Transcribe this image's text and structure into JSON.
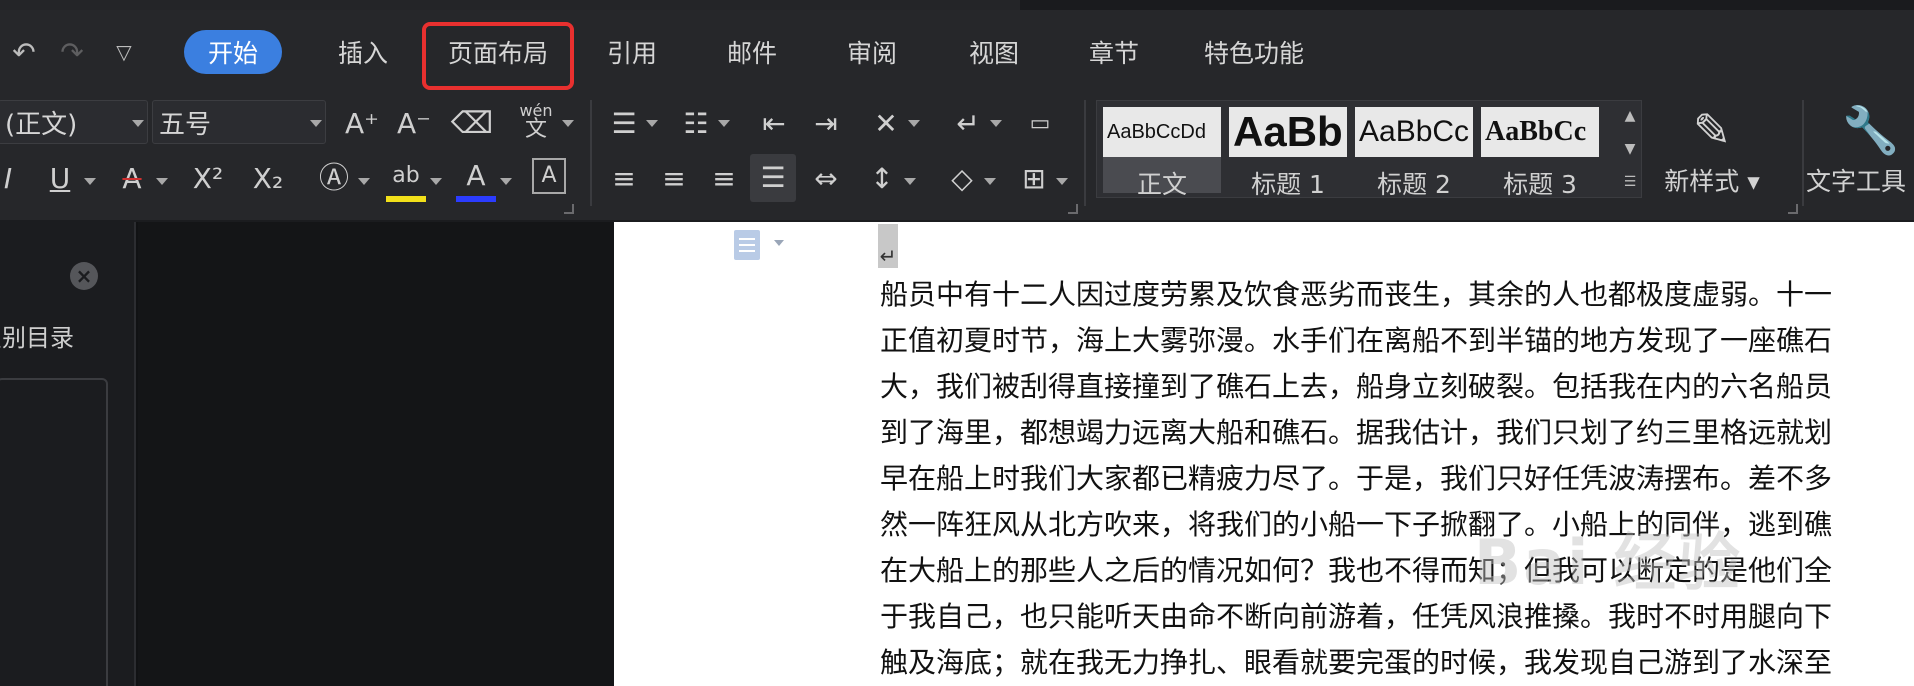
{
  "tabs": [
    {
      "label": "开始",
      "active": true
    },
    {
      "label": "插入"
    },
    {
      "label": "页面布局",
      "highlighted": true
    },
    {
      "label": "引用"
    },
    {
      "label": "邮件"
    },
    {
      "label": "审阅"
    },
    {
      "label": "视图"
    },
    {
      "label": "章节"
    },
    {
      "label": "特色功能"
    }
  ],
  "quick_access": {
    "undo_icon": "undo-icon",
    "redo_icon": "redo-icon",
    "customize_icon": "chevron-down-icon"
  },
  "ribbon": {
    "font_name": "(正文)",
    "font_size": "五号",
    "grow_font": "A⁺",
    "shrink_font": "A⁻",
    "phonetic": "wén",
    "superscript": "X²",
    "subscript": "X₂",
    "highlight": "ab",
    "styles": [
      {
        "preview": "AaBbCcDd",
        "label": "正文",
        "selected": true
      },
      {
        "preview": "AaBb",
        "label": "标题 1"
      },
      {
        "preview": "AaBbCc",
        "label": "标题 2"
      },
      {
        "preview": "AaBbCc",
        "label": "标题 3"
      }
    ],
    "new_style": "新样式",
    "text_tools": "文字工具"
  },
  "colors": {
    "accent": "#3b7fe0",
    "highlight_box": "#e8302f",
    "highlight_yellow": "#f2e01a",
    "font_color_blue": "#2b3cff",
    "font_color_red": "#d03030"
  },
  "nav": {
    "label": "识别目录",
    "close_icon": "close-icon"
  },
  "document": {
    "paragraph_mark": "↵",
    "lines": [
      "船员中有十二人因过度劳累及饮食恶劣而丧生，其余的人也都极度虚弱。十一",
      "正值初夏时节，海上大雾弥漫。水手们在离船不到半锚的地方发现了一座礁石",
      "大，我们被刮得直接撞到了礁石上去，船身立刻破裂。包括我在内的六名船员",
      "到了海里，都想竭力远离大船和礁石。据我估计，我们只划了约三里格远就划",
      "早在船上时我们大家都已精疲力尽了。于是，我们只好任凭波涛摆布。差不多",
      "然一阵狂风从北方吹来，将我们的小船一下子掀翻了。小船上的同伴，逃到礁",
      "在大船上的那些人之后的情况如何？我也不得而知；但我可以断定的是他们全",
      "于我自己，也只能听天由命不断向前游着，任凭风浪推搡。我时不时用腿向下",
      "触及海底；就在我无力挣扎、眼看就要完蛋的时候，我发现自己游到了水深至"
    ]
  },
  "watermark": "Bai 经验"
}
